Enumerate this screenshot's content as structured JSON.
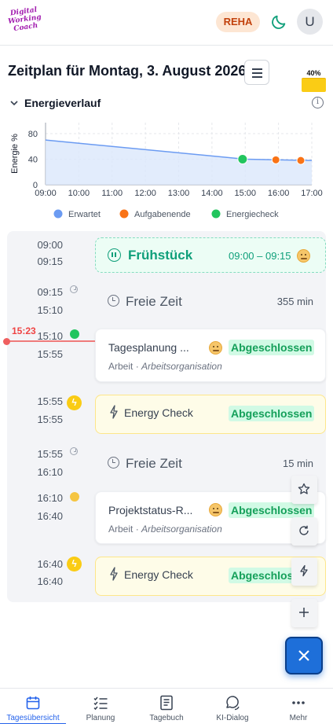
{
  "header": {
    "logo_lines": [
      "Digital",
      "Working",
      "Coach"
    ],
    "reha_label": "REHA",
    "avatar_letter": "U"
  },
  "page": {
    "title": "Zeitplan für Montag, 3. August 2026",
    "battery_percent_label": "40%",
    "battery_level": 0.4
  },
  "energy": {
    "section_label": "Energieverlauf"
  },
  "chart_data": {
    "type": "line",
    "ylabel": "Energie %",
    "xlabel": "",
    "ylim": [
      0,
      100
    ],
    "y_ticks": [
      "80",
      "40",
      "0"
    ],
    "x_ticks": [
      "09:00",
      "10:00",
      "11:00",
      "12:00",
      "13:00",
      "14:00",
      "15:00",
      "16:00",
      "17:00"
    ],
    "series": [
      {
        "name": "Erwartet",
        "color": "#6b9bf2",
        "points": [
          [
            9.0,
            70
          ],
          [
            15.0,
            40
          ],
          [
            17.0,
            38
          ]
        ]
      },
      {
        "name": "Aufgabenende",
        "color": "#f97316",
        "points": [
          [
            15.92,
            39
          ],
          [
            16.67,
            38
          ]
        ]
      },
      {
        "name": "Energiecheck",
        "color": "#22c55e",
        "points": [
          [
            14.92,
            40
          ]
        ]
      }
    ],
    "legend": [
      "Erwartet",
      "Aufgabenende",
      "Energiecheck"
    ],
    "legend_placement": "bottom",
    "grid": true
  },
  "timeline": {
    "now_label": "15:23",
    "rows": [
      {
        "start": "09:00",
        "end": "09:15"
      },
      {
        "start": "09:15",
        "end": "15:10"
      },
      {
        "start": "15:10",
        "end": "15:55"
      },
      {
        "start": "15:55",
        "end": "15:55"
      },
      {
        "start": "15:55",
        "end": "16:10"
      },
      {
        "start": "16:10",
        "end": "16:40"
      },
      {
        "start": "16:40",
        "end": "16:40"
      }
    ],
    "break_card": {
      "title": "Frühstück",
      "time": "09:00 – 09:15"
    },
    "free1": {
      "title": "Freie Zeit",
      "duration": "355 min"
    },
    "task1": {
      "title": "Tagesplanung ...",
      "status": "Abgeschlossen",
      "category": "Arbeit",
      "subcategory": "Arbeitsorganisation"
    },
    "energy1": {
      "title": "Energy Check",
      "status": "Abgeschlossen"
    },
    "free2": {
      "title": "Freie Zeit",
      "duration": "15 min"
    },
    "task2": {
      "title": "Projektstatus-R...",
      "status": "Abgeschlossen",
      "category": "Arbeit",
      "subcategory": "Arbeitsorganisation"
    },
    "energy2": {
      "title": "Energy Check",
      "status": "Abgeschloss"
    }
  },
  "nav": {
    "items": [
      {
        "label": "Tagesübersicht"
      },
      {
        "label": "Planung"
      },
      {
        "label": "Tagebuch"
      },
      {
        "label": "KI-Dialog"
      },
      {
        "label": "Mehr"
      }
    ]
  },
  "colors": {
    "accent": "#2563eb",
    "success": "#15a05a",
    "warning": "#facc15",
    "now": "#ef4444"
  }
}
